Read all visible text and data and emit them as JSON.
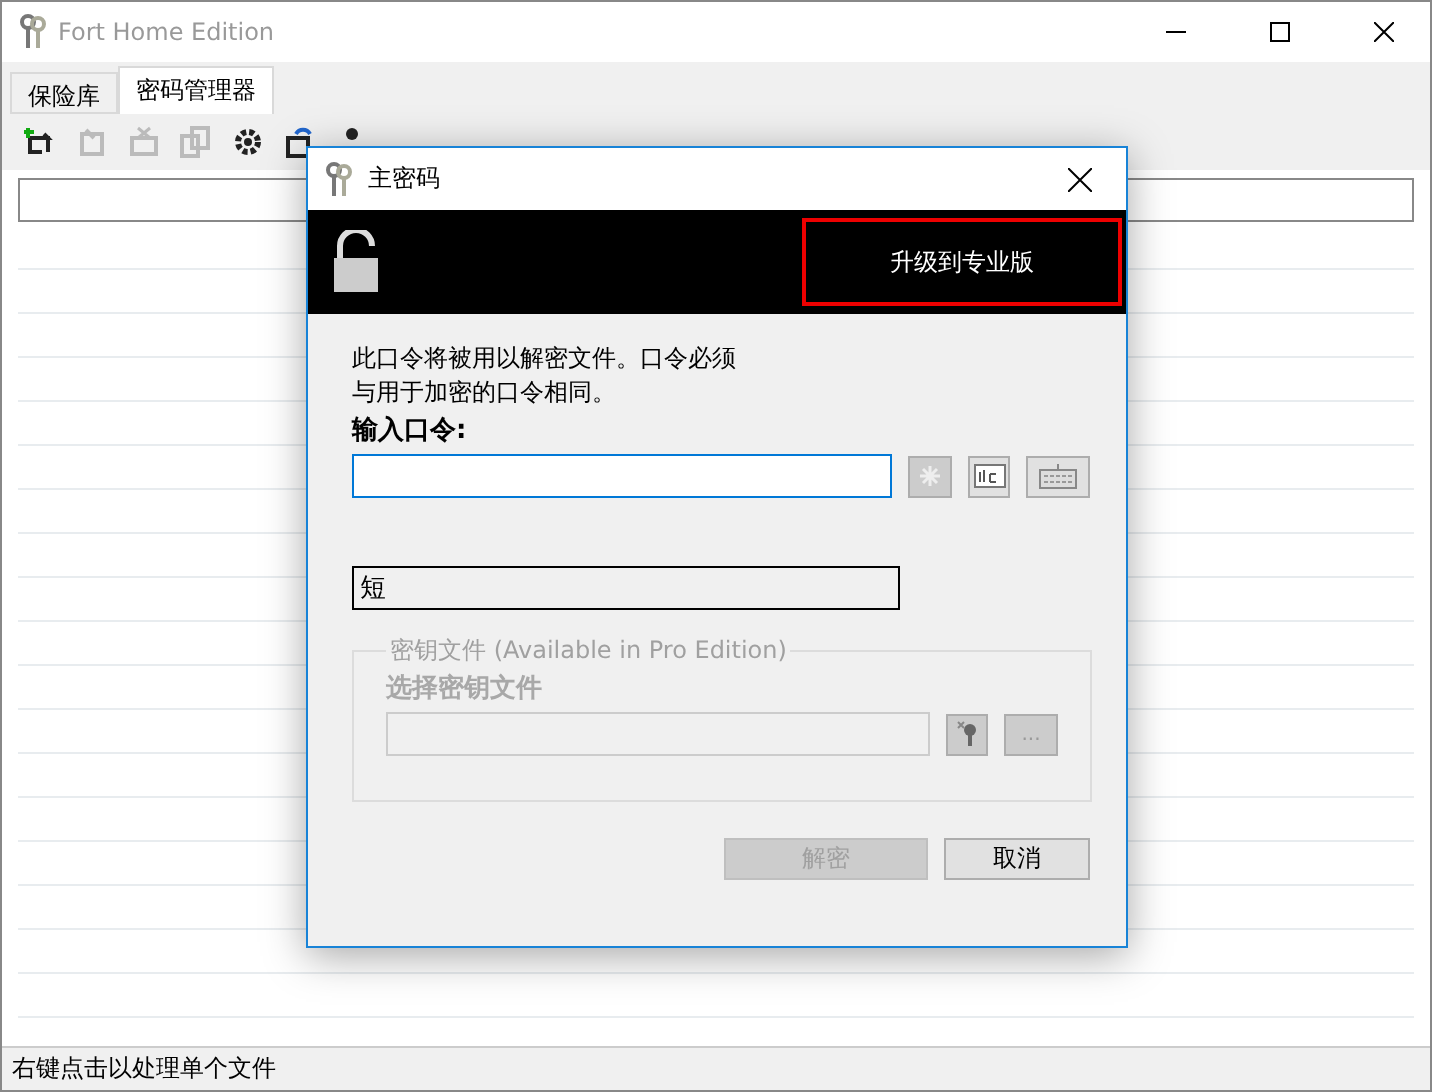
{
  "window": {
    "title": "Fort Home Edition"
  },
  "tabs": [
    {
      "label": "保险库",
      "selected": false
    },
    {
      "label": "密码管理器",
      "selected": true
    }
  ],
  "toolbar": [
    {
      "kind": "add",
      "disabled": false
    },
    {
      "kind": "edit",
      "disabled": true
    },
    {
      "kind": "delete",
      "disabled": true
    },
    {
      "kind": "copy",
      "disabled": true
    },
    {
      "kind": "settings",
      "disabled": false
    },
    {
      "kind": "refresh",
      "disabled": false
    },
    {
      "kind": "user",
      "disabled": false
    }
  ],
  "status_bar": "右键点击以处理单个文件",
  "dialog": {
    "title": "主密码",
    "upgrade_button": "升级到专业版",
    "description": [
      "此口令将被用以解密文件。口令必须",
      "与用于加密的口令相同。"
    ],
    "password_label": "输入口令:",
    "field_buttons": [
      {
        "kind": "asterisk",
        "disabled": true
      },
      {
        "kind": "abc",
        "disabled": false
      },
      {
        "kind": "keyboard",
        "disabled": false
      }
    ],
    "strength": "短",
    "key_file": {
      "legend": "密钥文件 (Available in Pro Edition)",
      "label": "选择密钥文件",
      "disabled": true,
      "browse": "..."
    },
    "buttons": [
      {
        "label": "解密",
        "disabled": true
      },
      {
        "label": "取消",
        "disabled": false
      }
    ]
  }
}
